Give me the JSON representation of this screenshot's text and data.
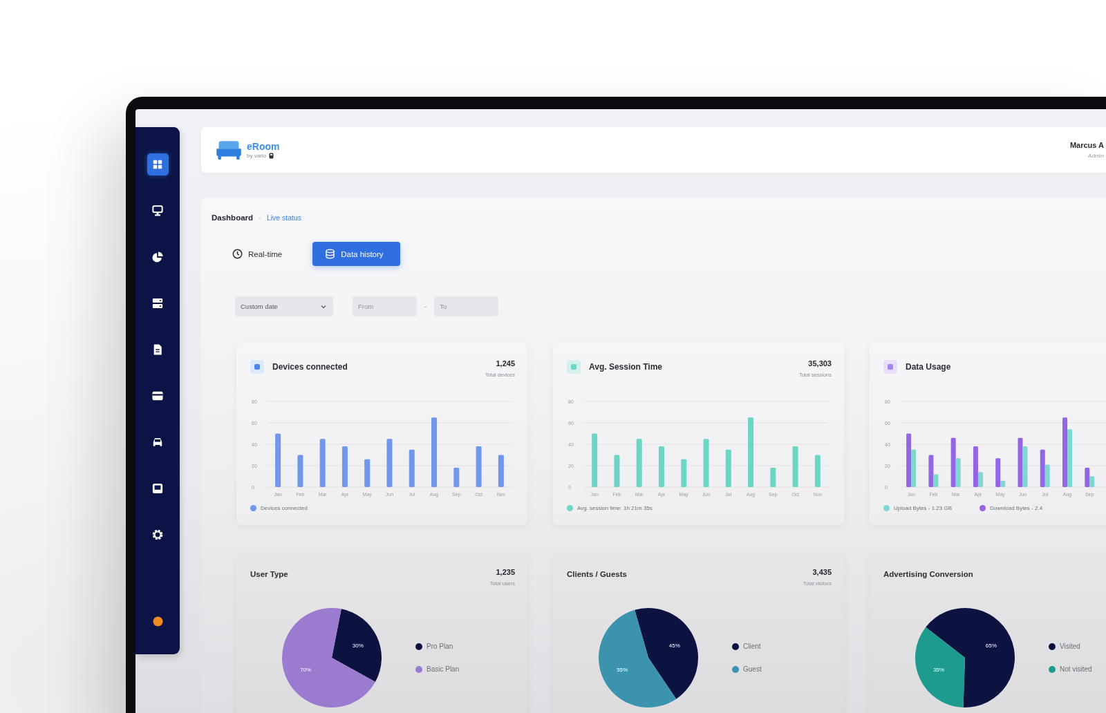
{
  "sidebar": {
    "items": [
      {
        "selected": true
      },
      {
        "selected": false
      },
      {
        "selected": false
      },
      {
        "selected": false
      },
      {
        "selected": false
      },
      {
        "selected": false
      },
      {
        "selected": false
      },
      {
        "selected": false
      },
      {
        "selected": false
      }
    ]
  },
  "header": {
    "logo": {
      "name": "eRoom",
      "tagline": "by vario"
    },
    "user": {
      "name": "Marcus A",
      "role": "Admin"
    }
  },
  "breadcrumb": {
    "items": [
      "Dashboard",
      "Live status"
    ],
    "separator": "·"
  },
  "view_buttons": [
    {
      "label": "Real-time",
      "selected": false
    },
    {
      "label": "Data history",
      "selected": true
    }
  ],
  "filters": {
    "range": {
      "value": "Custom date"
    },
    "from": {
      "placeholder": "From"
    },
    "separator": "-",
    "to": {
      "placeholder": "To"
    }
  },
  "metric_cards": [
    {
      "title": "Devices connected",
      "value": "1,245",
      "subtitle": "Total devices",
      "chart_data": {
        "type": "bar",
        "grid": true,
        "categories": [
          "Jan",
          "Feb",
          "Mar",
          "Apr",
          "May",
          "Jun",
          "Jul",
          "Aug",
          "Sep",
          "Oct",
          "Nov"
        ],
        "yticks": [
          0,
          20,
          40,
          60,
          80
        ],
        "ylim": [
          0,
          80
        ],
        "series": [
          {
            "name": "Devices connected",
            "color": "#6f97ec",
            "values": [
              50,
              30,
              45,
              38,
              26,
              45,
              35,
              65,
              18,
              38,
              30
            ]
          }
        ]
      }
    },
    {
      "title": "Avg. Session Time",
      "value": "35,303",
      "subtitle": "Total sessions",
      "chart_data": {
        "type": "bar",
        "grid": true,
        "categories": [
          "Jan",
          "Feb",
          "Mar",
          "Apr",
          "May",
          "Jun",
          "Jul",
          "Aug",
          "Sep",
          "Oct",
          "Nov"
        ],
        "yticks": [
          0,
          20,
          40,
          60,
          80
        ],
        "ylim": [
          0,
          80
        ],
        "series": [
          {
            "name": "Avg. session time: 1h 21m 35s",
            "color": "#6dd5c6",
            "values": [
              50,
              30,
              45,
              38,
              26,
              45,
              35,
              65,
              18,
              38,
              30
            ]
          }
        ]
      }
    },
    {
      "title": "Data Usage",
      "chart_data": {
        "type": "bar",
        "grid": true,
        "categories": [
          "Jan",
          "Feb",
          "Mar",
          "Apr",
          "May",
          "Jun",
          "Jul",
          "Aug",
          "Sep"
        ],
        "yticks": [
          0,
          20,
          40,
          60,
          80
        ],
        "ylim": [
          0,
          80
        ],
        "series": [
          {
            "name": "Upload Bytes - 1.23 GB",
            "color": "#7fd6d4",
            "values": [
              35,
              12,
              27,
              14,
              6,
              38,
              21,
              54,
              10
            ]
          },
          {
            "name": "Download Bytes - 2.4",
            "color": "#9466e6",
            "values": [
              50,
              30,
              46,
              38,
              27,
              46,
              35,
              65,
              18
            ]
          }
        ]
      }
    }
  ],
  "breakdown_cards": [
    {
      "title": "User Type",
      "value": "1,235",
      "subtitle": "Total users",
      "chart_data": {
        "type": "pie",
        "categories": [
          "Pro Plan",
          "Basic Plan"
        ],
        "values": [
          30,
          70
        ],
        "colors": [
          "#0c1340",
          "#9b7bd0"
        ],
        "value_labels": [
          "30%",
          "70%"
        ]
      }
    },
    {
      "title": "Clients / Guests",
      "value": "3,435",
      "subtitle": "Total visitors",
      "chart_data": {
        "type": "pie",
        "categories": [
          "Client",
          "Guest"
        ],
        "values": [
          45,
          55
        ],
        "colors": [
          "#0c1340",
          "#3b93ad"
        ],
        "value_labels": [
          "45%",
          "55%"
        ]
      }
    },
    {
      "title": "Advertising Conversion",
      "chart_data": {
        "type": "pie",
        "categories": [
          "Visited",
          "Not visited"
        ],
        "values": [
          65,
          35
        ],
        "colors": [
          "#0c1340",
          "#1e9b8f"
        ],
        "value_labels": [
          "65%",
          "35%"
        ]
      }
    }
  ]
}
